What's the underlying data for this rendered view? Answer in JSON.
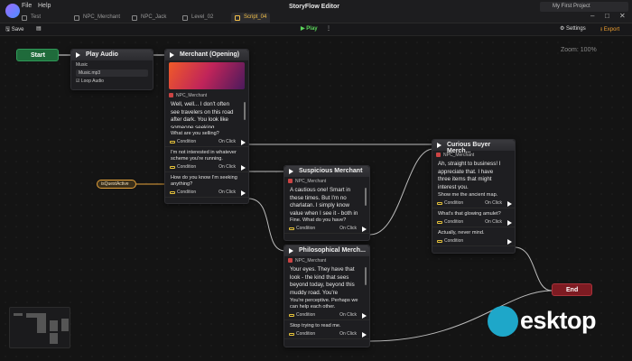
{
  "window": {
    "menu": [
      "File",
      "Help"
    ],
    "title": "StoryFlow Editor",
    "project": "My First Project",
    "tabs": [
      "Test",
      "NPC_Merchant",
      "NPC_Jack",
      "Level_02",
      "Script_04"
    ],
    "active_tab_index": 4
  },
  "toolbar": {
    "save_label": "Save",
    "play_label": "Play",
    "settings_label": "Settings",
    "export_label": "Export"
  },
  "canvas": {
    "zoom_label": "Zoom: 100%",
    "quest_variable": "isQuestActive"
  },
  "nodes": {
    "start": {
      "label": "Start"
    },
    "end": {
      "label": "End"
    },
    "play_audio": {
      "title": "Play Audio",
      "field_label": "Music",
      "file": "Music.mp3",
      "loop_label": "Loop Audio"
    },
    "merchant_opening": {
      "title": "Merchant (Opening)",
      "speaker": "NPC_Merchant",
      "text": "Well, well... I don't often see travelers on this road after dark. You look like someone seeking... opportunity.",
      "choices": [
        {
          "text": "What are you selling?",
          "condition": "Condition",
          "trigger": "On Click"
        },
        {
          "text": "I'm not interested in whatever scheme you're running.",
          "condition": "Condition",
          "trigger": "On Click"
        },
        {
          "text": "How do you know I'm seeking anything?",
          "condition": "Condition",
          "trigger": "On Click"
        }
      ]
    },
    "suspicious_merchant": {
      "title": "Suspicious Merchant",
      "speaker": "NPC_Merchant",
      "text": "A cautious one! Smart in these times. But I'm no charlatan. I simply know value when I see it - both in things and people.",
      "choices": [
        {
          "text": "Fine. What do you have?",
          "condition": "Condition",
          "trigger": "On Click"
        }
      ]
    },
    "philosophical_merchant": {
      "title": "Philosophical Merch...",
      "speaker": "NPC_Merchant",
      "text": "Your eyes. They have that look - the kind that sees beyond today, beyond this muddy road. You're",
      "choices": [
        {
          "text": "You're perceptive. Perhaps we can help each other.",
          "condition": "Condition",
          "trigger": "On Click"
        },
        {
          "text": "Stop trying to read me.",
          "condition": "Condition",
          "trigger": "On Click"
        }
      ]
    },
    "curious_buyer": {
      "title": "Curious Buyer Merch...",
      "speaker": "NPC_Merchant",
      "text": "Ah, straight to business! I appreciate that. I have three items that might interest you.",
      "choices": [
        {
          "text": "Show me the ancient map.",
          "condition": "Condition",
          "trigger": "On Click"
        },
        {
          "text": "What's that glowing amulet?",
          "condition": "Condition",
          "trigger": "On Click"
        },
        {
          "text": "Actually, never mind.",
          "condition": "Condition",
          "trigger": ""
        }
      ]
    }
  },
  "watermark": {
    "text": "esktop"
  },
  "colors": {
    "start": "#1f6b3b",
    "end": "#7e1b22",
    "accent_tab": "#f3c04a",
    "play": "#5bd65b",
    "export": "#f0a030"
  }
}
